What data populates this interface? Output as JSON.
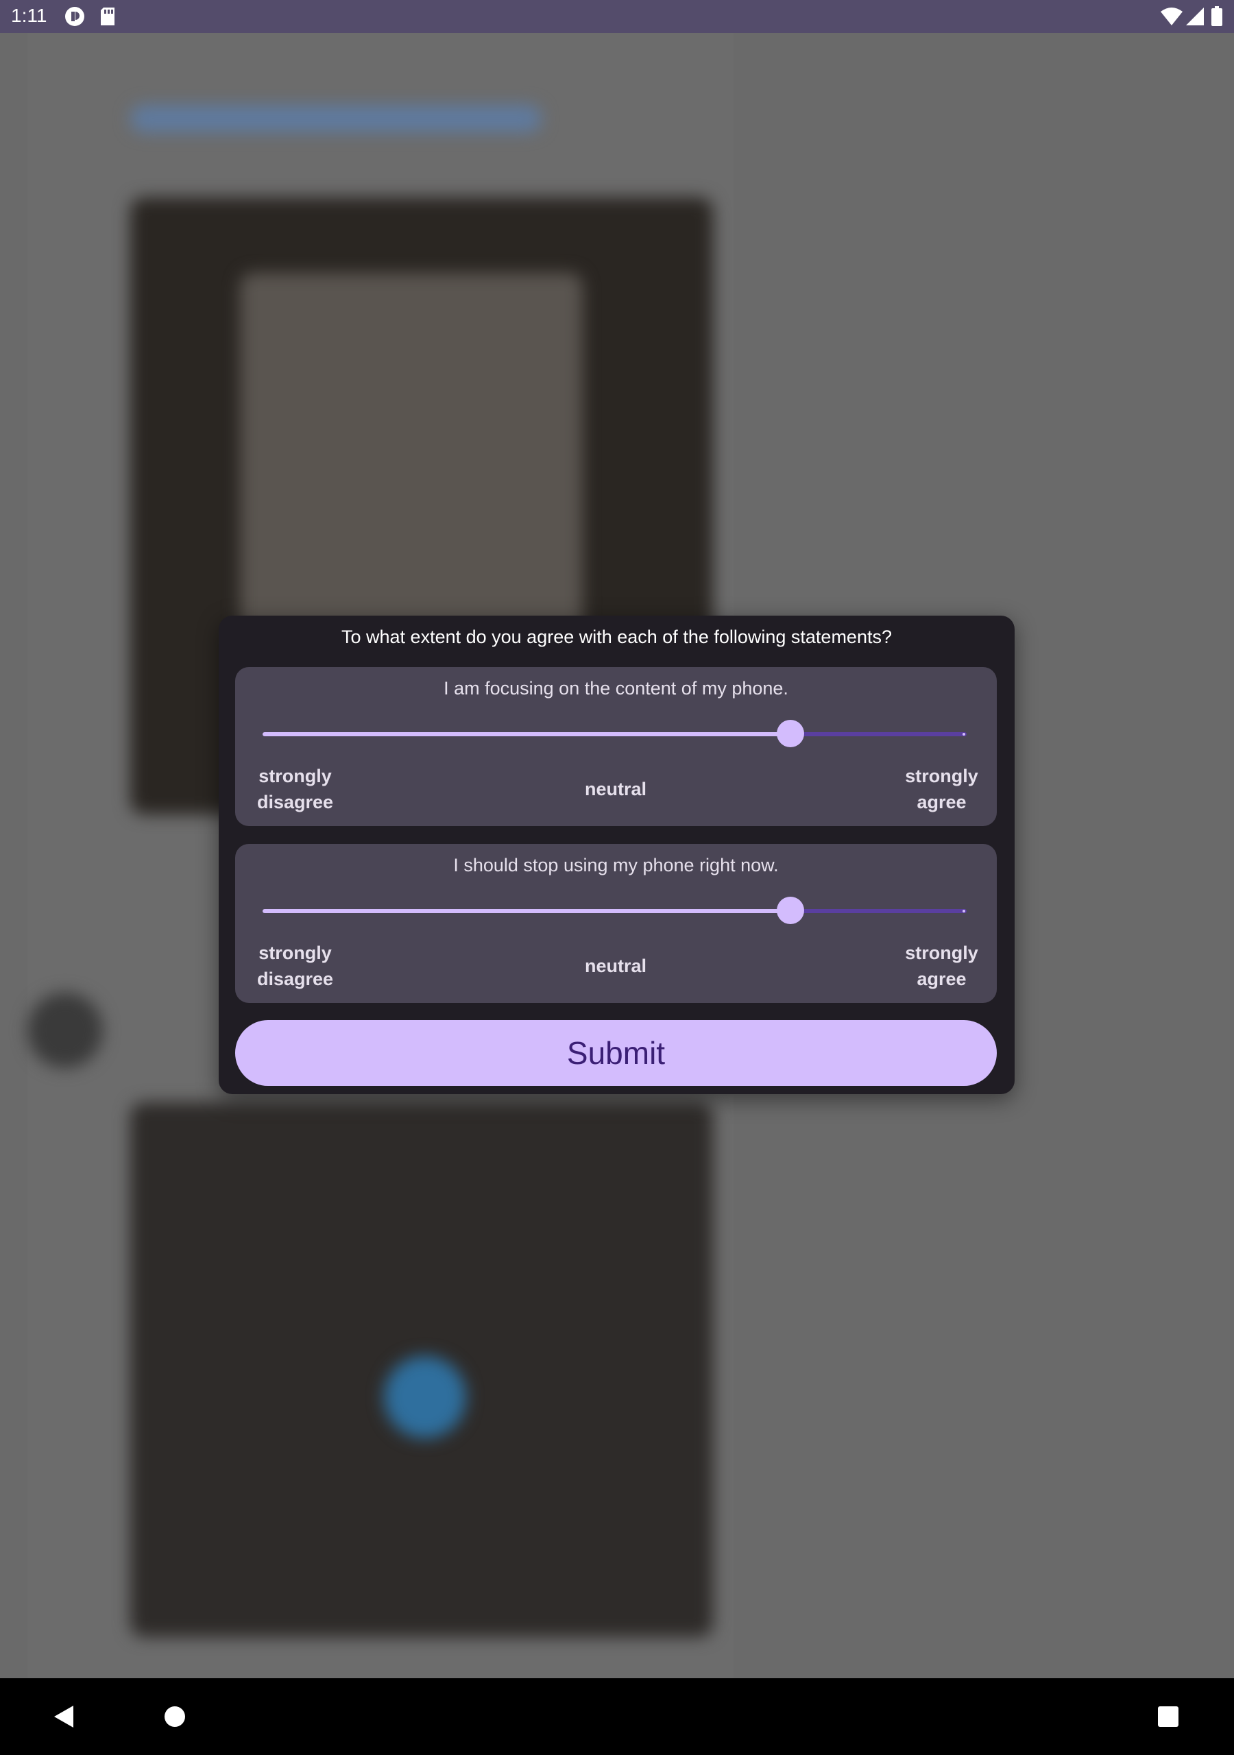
{
  "status_bar": {
    "time": "1:11",
    "icons": [
      "app-notification-icon",
      "sd-card-icon",
      "wifi-icon",
      "signal-icon",
      "battery-icon"
    ]
  },
  "dialog": {
    "title": "To what extent do you agree with each of the following statements?",
    "questions": [
      {
        "statement": "I am focusing on the content of my phone.",
        "slider_value": 0.75,
        "label_left": "strongly\ndisagree",
        "label_middle": "neutral",
        "label_right": "strongly\nagree"
      },
      {
        "statement": "I should stop using my phone right now.",
        "slider_value": 0.75,
        "label_left": "strongly\ndisagree",
        "label_middle": "neutral",
        "label_right": "strongly\nagree"
      }
    ],
    "submit_label": "Submit"
  },
  "nav_bar": {
    "buttons": [
      "back-icon",
      "home-icon",
      "recents-icon"
    ]
  },
  "colors": {
    "accent": "#d3bcfd",
    "accent_dark": "#5a3fa0",
    "dialog_bg": "#201d24",
    "card_bg": "#4a4555",
    "status_bar": "#544c6b",
    "scrim": "#6a6a6a"
  }
}
